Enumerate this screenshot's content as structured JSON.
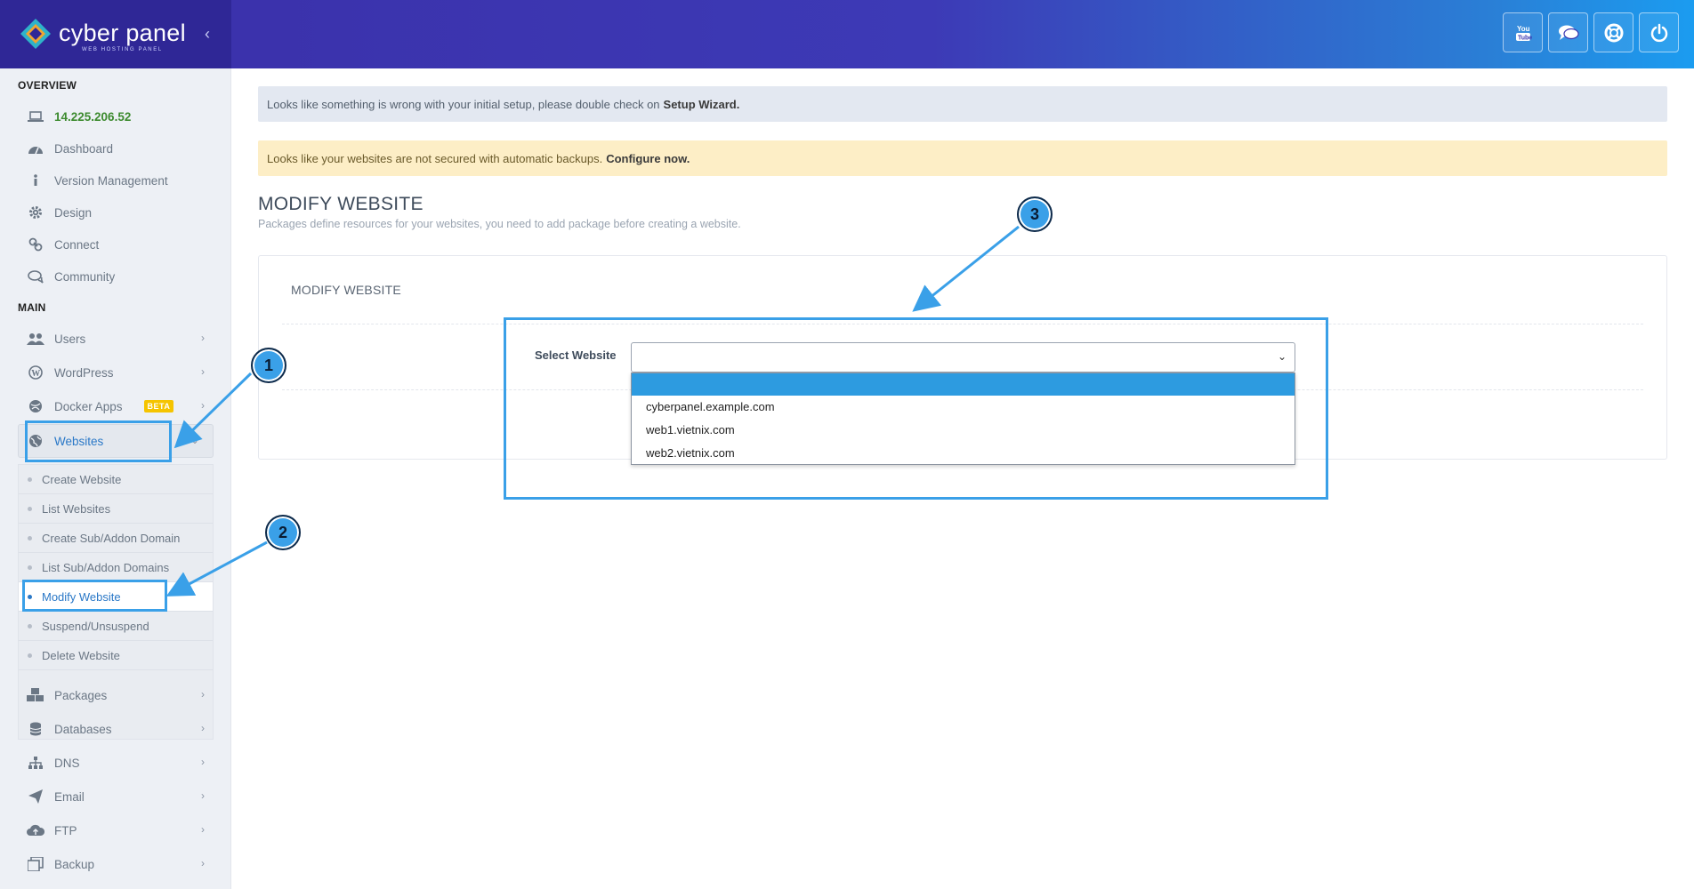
{
  "header": {
    "logo_text": "cyber panel",
    "logo_subtext": "WEB HOSTING PANEL",
    "buttons": [
      {
        "name": "youtube-icon"
      },
      {
        "name": "chat-icon"
      },
      {
        "name": "support-icon"
      },
      {
        "name": "power-icon"
      }
    ]
  },
  "sidebar": {
    "overview_label": "OVERVIEW",
    "main_label": "MAIN",
    "overview_items": [
      {
        "label": "14.225.206.52",
        "icon": "laptop-icon"
      },
      {
        "label": "Dashboard",
        "icon": "dashboard-icon"
      },
      {
        "label": "Version Management",
        "icon": "info-icon"
      },
      {
        "label": "Design",
        "icon": "gear-icon"
      },
      {
        "label": "Connect",
        "icon": "link-icon"
      },
      {
        "label": "Community",
        "icon": "comments-icon"
      }
    ],
    "main_items": [
      {
        "label": "Users",
        "icon": "users-icon"
      },
      {
        "label": "WordPress",
        "icon": "wordpress-icon"
      },
      {
        "label": "Docker Apps",
        "icon": "docker-icon",
        "badge": "BETA"
      },
      {
        "label": "Websites",
        "icon": "globe-icon"
      }
    ],
    "websites_submenu": [
      {
        "label": "Create Website"
      },
      {
        "label": "List Websites"
      },
      {
        "label": "Create Sub/Addon Domain"
      },
      {
        "label": "List Sub/Addon Domains"
      },
      {
        "label": "Modify Website"
      },
      {
        "label": "Suspend/Unsuspend"
      },
      {
        "label": "Delete Website"
      }
    ],
    "lower_items": [
      {
        "label": "Packages",
        "icon": "cubes-icon"
      },
      {
        "label": "Databases",
        "icon": "database-icon"
      },
      {
        "label": "DNS",
        "icon": "sitemap-icon"
      },
      {
        "label": "Email",
        "icon": "paper-plane-icon"
      },
      {
        "label": "FTP",
        "icon": "cloud-upload-icon"
      },
      {
        "label": "Backup",
        "icon": "backup-icon"
      }
    ]
  },
  "alerts": {
    "setup_text": "Looks like something is wrong with your initial setup, please double check on",
    "setup_link": "Setup Wizard.",
    "backup_text": "Looks like your websites are not secured with automatic backups.",
    "backup_link": "Configure now."
  },
  "page": {
    "title": "MODIFY WEBSITE",
    "subtitle": "Packages define resources for your websites, you need to add package before creating a website."
  },
  "panel": {
    "title": "MODIFY WEBSITE",
    "field_label": "Select Website",
    "selected_value": "",
    "options": [
      "",
      "cyberpanel.example.com",
      "web1.vietnix.com",
      "web2.vietnix.com"
    ]
  },
  "annotations": [
    "1",
    "2",
    "3"
  ],
  "colors": {
    "accent": "#3aa0e8",
    "header_start": "#3a2fa8",
    "header_end": "#1b9cf0",
    "ip_green": "#3c8a2e",
    "active_blue": "#2a78c7",
    "beta_yellow": "#f5c400",
    "dropdown_highlight": "#2d9be0"
  }
}
